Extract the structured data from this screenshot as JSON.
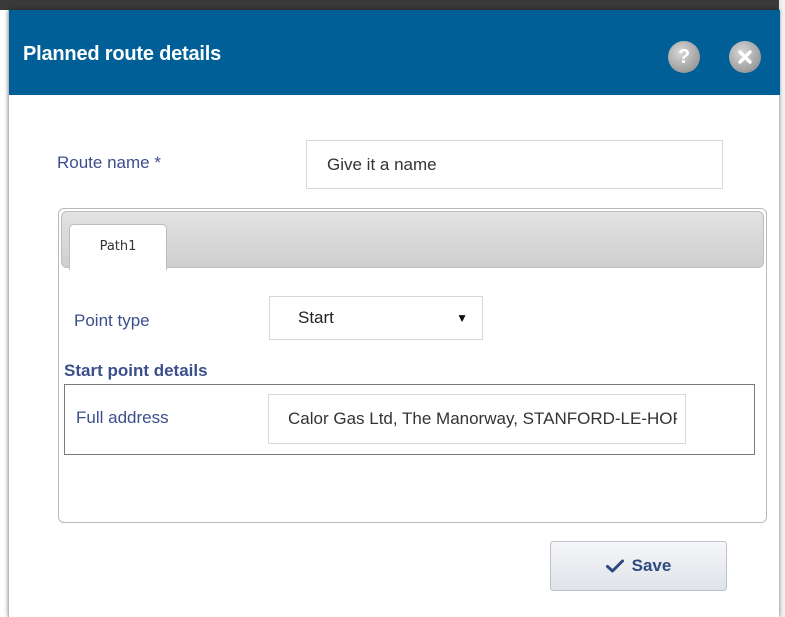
{
  "dialog": {
    "title": "Planned route details",
    "help_glyph": "?",
    "close_icon": "close-icon",
    "help_icon": "help-icon",
    "header_color": "#005f96",
    "label_color": "#3c4f8c"
  },
  "route": {
    "label": "Route name *",
    "placeholder": "Give it a name",
    "value": ""
  },
  "tabs": [
    {
      "label": "Path1",
      "active": true
    }
  ],
  "point_type": {
    "label": "Point type",
    "selected": "Start"
  },
  "start_point": {
    "section_title": "Start point details",
    "address_label": "Full address",
    "address_value": "Calor Gas Ltd, The Manorway, STANFORD-LE-HOPE"
  },
  "actions": {
    "save_label": "Save",
    "save_icon": "checkmark-icon"
  }
}
